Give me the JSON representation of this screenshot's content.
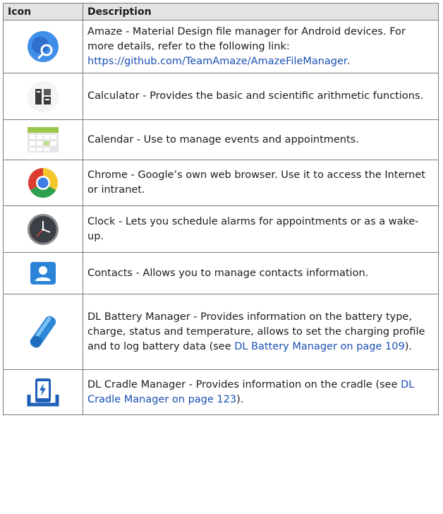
{
  "table": {
    "header": {
      "icon": "Icon",
      "description": "Description"
    },
    "rows": [
      {
        "icon": "amaze-icon",
        "parts": [
          "Amaze - Material Design file manager for Android devices. For more details, refer to the following link: ",
          ".",
          "",
          ""
        ],
        "link": "https://github.com/TeamAmaze/AmazeFileManager"
      },
      {
        "icon": "calculator-icon",
        "text": "Calculator - Provides the basic and scientific arithmetic functions."
      },
      {
        "icon": "calendar-icon",
        "text": "Calendar - Use to manage events and appointments."
      },
      {
        "icon": "chrome-icon",
        "text": "Chrome - Google’s own web browser. Use it to access the Internet or intranet."
      },
      {
        "icon": "clock-icon",
        "text": "Clock - Lets you schedule alarms for appointments or as a wake-up."
      },
      {
        "icon": "contacts-icon",
        "text": "Contacts - Allows you to manage contacts information."
      },
      {
        "icon": "battery-manager-icon",
        "text": "DL Battery Manager - Provides information on the battery type, charge, status and temperature, allows to set the charging profile and to log battery data (see ",
        "link": "DL Battery Manager on page 109",
        "after": ")."
      },
      {
        "icon": "cradle-manager-icon",
        "text": "DL Cradle Manager - Provides information on the cradle (see ",
        "link": "DL Cradle Manager on page 123",
        "after": ")."
      }
    ]
  },
  "colors": {
    "link": "#1a4fb3",
    "header_bg": "#e3e3e3",
    "border": "#7a7a7a"
  }
}
